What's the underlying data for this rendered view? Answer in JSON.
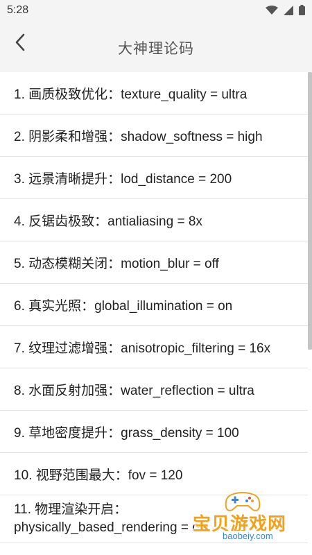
{
  "status_bar": {
    "time": "5:28"
  },
  "app_bar": {
    "title": "大神理论码"
  },
  "items": [
    {
      "text": "1. 画质极致优化：texture_quality = ultra"
    },
    {
      "text": "2. 阴影柔和增强：shadow_softness = high"
    },
    {
      "text": "3. 远景清晰提升：lod_distance = 200"
    },
    {
      "text": "4. 反锯齿极致：antialiasing = 8x"
    },
    {
      "text": "5. 动态模糊关闭：motion_blur = off"
    },
    {
      "text": "6. 真实光照：global_illumination = on"
    },
    {
      "text": "7. 纹理过滤增强：anisotropic_filtering = 16x"
    },
    {
      "text": "8. 水面反射加强：water_reflection = ultra"
    },
    {
      "text": "9. 草地密度提升：grass_density = 100"
    },
    {
      "text": "10. 视野范围最大：fov = 120"
    },
    {
      "line1": "11. 物理渲染开启：",
      "line2": "physically_based_rendering = on"
    }
  ],
  "watermark": {
    "name": "宝贝游戏网",
    "url": "baobeiy.com"
  },
  "colors": {
    "watermark_orange": "#f2a11a",
    "watermark_blue": "#3b86d6"
  }
}
